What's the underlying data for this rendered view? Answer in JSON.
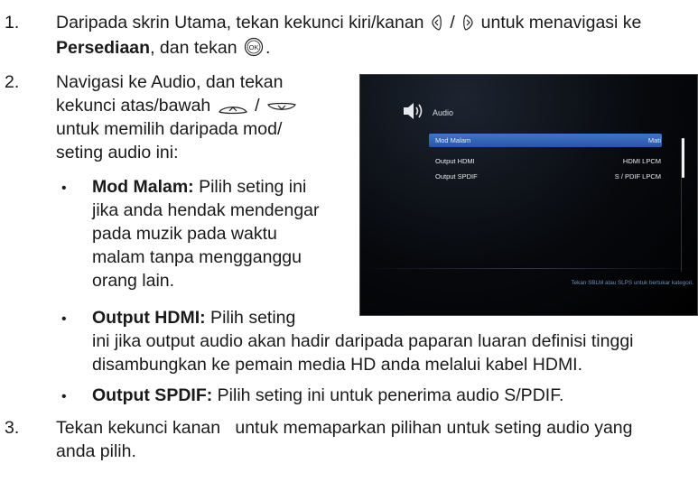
{
  "steps": [
    {
      "number": "1.",
      "line1_a": "Daripada skrin Utama, tekan kekunci kiri/kanan",
      "line1_sep": "/",
      "line1_b": "untuk menavigasi ke",
      "line2_bold": "Persediaan",
      "line2_text": ", dan tekan",
      "line2_end": "."
    },
    {
      "number": "2.",
      "lines": [
        "Navigasi ke Audio, dan tekan",
        "kekunci atas/bawah",
        "untuk memilih daripada mod/",
        "seting audio ini:"
      ],
      "updown_sep": "/"
    },
    {
      "number": "3.",
      "lines": [
        "Tekan kekunci kanan   untuk memaparkan pilihan untuk seting audio yang",
        "anda pilih."
      ]
    }
  ],
  "bullets": [
    {
      "marker": "•",
      "term": "Mod Malam:",
      "lines": [
        " Pilih seting ini",
        "jika anda hendak mendengar",
        "pada muzik pada waktu",
        "malam tanpa mengganggu",
        "orang lain."
      ]
    },
    {
      "marker": "•",
      "term": "Output HDMI:",
      "lines": [
        " Pilih seting",
        "ini jika output audio akan hadir daripada paparan luaran definisi tinggi",
        "disambungkan ke pemain media HD anda melalui kabel HDMI."
      ]
    },
    {
      "marker": "•",
      "term": "Output SPDIF:",
      "lines": [
        " Pilih seting ini untuk penerima audio S/PDIF."
      ]
    }
  ],
  "screen": {
    "title": "Audio",
    "rows": [
      {
        "label": "Mod Malam",
        "value": "Mati"
      },
      {
        "label": "Output HDMI",
        "value": "HDMI LPCM"
      },
      {
        "label": "Output SPDIF",
        "value": "S / PDIF LPCM"
      }
    ],
    "hint": "Tekan SBLM atau SLPS untuk bertukar kategori."
  },
  "icons": {
    "left": "left-arrow-key-icon",
    "right": "right-arrow-key-icon",
    "ok": "ok-button-icon",
    "up": "up-arrow-key-icon",
    "down": "down-arrow-key-icon",
    "speaker": "speaker-icon"
  },
  "colors": {
    "highlight": "#2f62b8",
    "hint_text": "#6f8fc0"
  }
}
